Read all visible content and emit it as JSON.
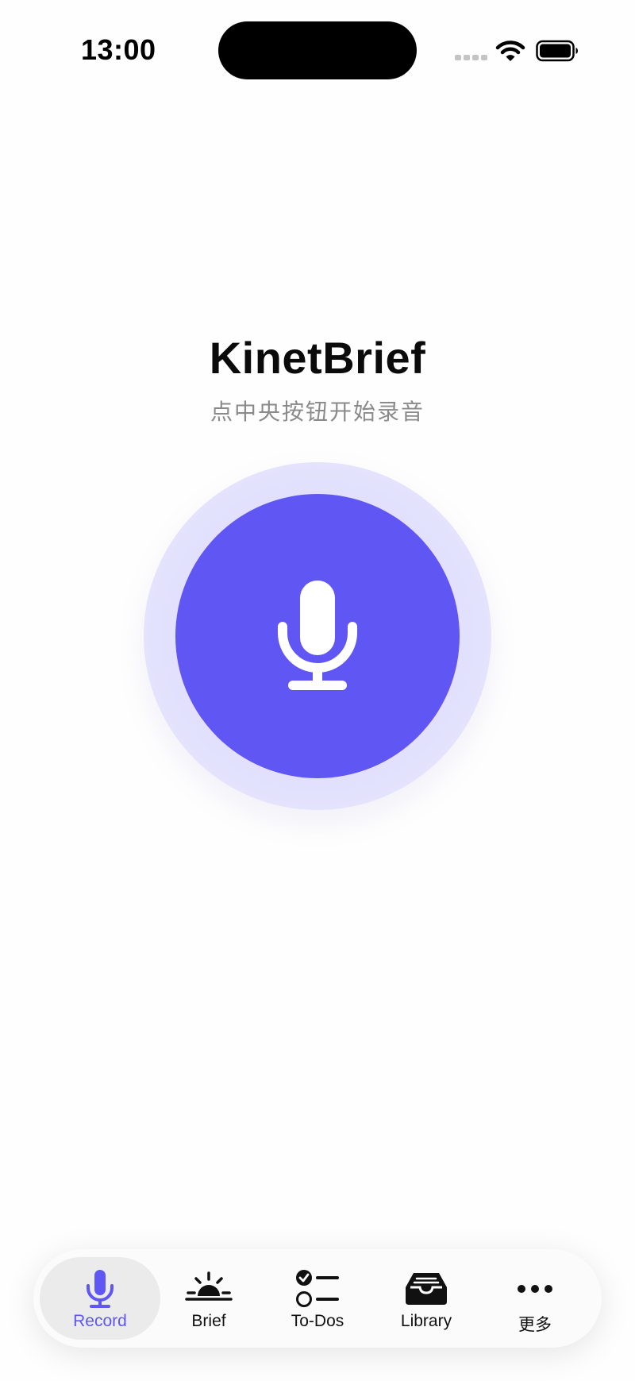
{
  "status_bar": {
    "time": "13:00"
  },
  "main": {
    "title": "KinetBrief",
    "subtitle": "点中央按钮开始录音",
    "record_button": {
      "icon": "microphone-icon"
    }
  },
  "tabbar": {
    "tabs": [
      {
        "label": "Record",
        "icon": "microphone-icon",
        "active": true
      },
      {
        "label": "Brief",
        "icon": "sunrise-icon",
        "active": false
      },
      {
        "label": "To-Dos",
        "icon": "checklist-icon",
        "active": false
      },
      {
        "label": "Library",
        "icon": "inbox-tray-icon",
        "active": false
      },
      {
        "label": "更多",
        "icon": "ellipsis-icon",
        "active": false
      }
    ]
  },
  "colors": {
    "accent": "#5F56F3",
    "halo": "#E4E3FD",
    "subtitle": "#8A8A8A",
    "tab_active_bg": "#EBEBEB"
  }
}
